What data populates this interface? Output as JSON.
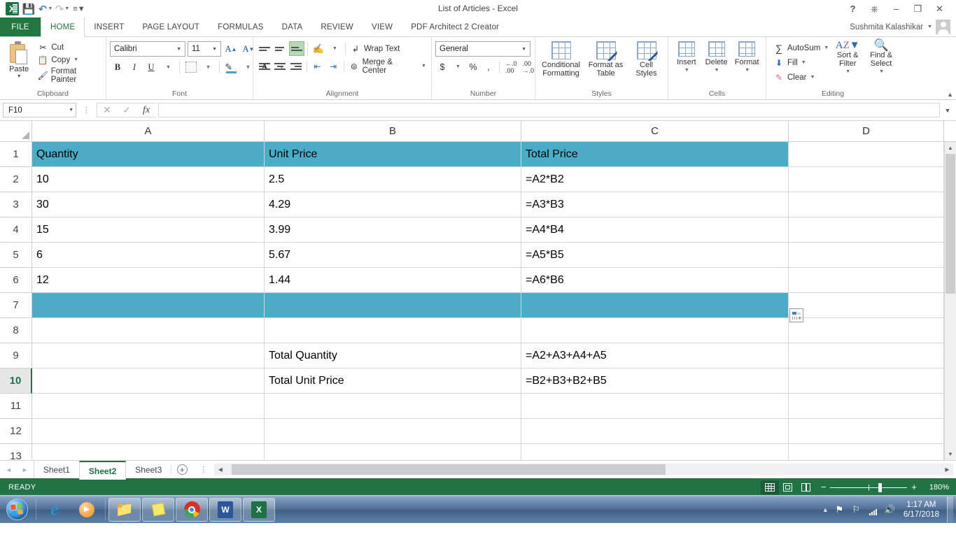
{
  "titlebar": {
    "title": "List of Articles - Excel",
    "quick_access": [
      {
        "name": "save",
        "label": "Save"
      },
      {
        "name": "undo",
        "label": "Undo"
      },
      {
        "name": "redo",
        "label": "Redo"
      },
      {
        "name": "customize",
        "label": "Customize Quick Access Toolbar"
      }
    ],
    "help_label": "?",
    "ribbon_options_label": "Ribbon Display Options",
    "minimize_label": "–",
    "restore_label": "❐",
    "close_label": "✕"
  },
  "ribbon": {
    "tabs": [
      {
        "label": "FILE",
        "active": false
      },
      {
        "label": "HOME",
        "active": true
      },
      {
        "label": "INSERT",
        "active": false
      },
      {
        "label": "PAGE LAYOUT",
        "active": false
      },
      {
        "label": "FORMULAS",
        "active": false
      },
      {
        "label": "DATA",
        "active": false
      },
      {
        "label": "REVIEW",
        "active": false
      },
      {
        "label": "VIEW",
        "active": false
      },
      {
        "label": "PDF Architect 2 Creator",
        "active": false
      }
    ],
    "user_name": "Sushmita Kalashikar",
    "clipboard": {
      "group_label": "Clipboard",
      "paste_label": "Paste",
      "cut_label": "Cut",
      "copy_label": "Copy",
      "format_painter_label": "Format Painter"
    },
    "font": {
      "group_label": "Font",
      "font_name": "Calibri",
      "font_size": "11",
      "grow_label": "A",
      "shrink_label": "A",
      "bold_label": "B",
      "italic_label": "I",
      "underline_label": "U",
      "borders_label": "Borders",
      "fill_color_label": "Fill Color",
      "font_color_label": "A"
    },
    "alignment": {
      "group_label": "Alignment",
      "top_align_label": "Top Align",
      "middle_align_label": "Middle Align",
      "bottom_align_label": "Bottom Align",
      "orientation_label": "Orientation",
      "align_left_label": "Align Left",
      "center_label": "Center",
      "align_right_label": "Align Right",
      "decrease_indent_label": "Decrease Indent",
      "increase_indent_label": "Increase Indent",
      "wrap_text_label": "Wrap Text",
      "merge_center_label": "Merge & Center"
    },
    "number": {
      "group_label": "Number",
      "format": "General",
      "accounting_label": "$",
      "percent_label": "%",
      "comma_label": ",",
      "increase_decimal_label": "Increase Decimal",
      "decrease_decimal_label": "Decrease Decimal"
    },
    "styles": {
      "group_label": "Styles",
      "conditional_formatting_label": "Conditional Formatting",
      "format_as_table_label": "Format as Table",
      "cell_styles_label": "Cell Styles"
    },
    "cells": {
      "group_label": "Cells",
      "insert_label": "Insert",
      "delete_label": "Delete",
      "format_label": "Format"
    },
    "editing": {
      "group_label": "Editing",
      "autosum_label": "AutoSum",
      "fill_label": "Fill",
      "clear_label": "Clear",
      "sort_filter_label": "Sort & Filter",
      "find_select_label": "Find & Select"
    }
  },
  "formula_bar": {
    "name_box": "F10",
    "cancel_label": "✕",
    "enter_label": "✓",
    "function_label": "fx",
    "formula_value": "",
    "formula_placeholder": ""
  },
  "grid": {
    "column_headers": [
      "A",
      "B",
      "C",
      "D"
    ],
    "row_headers": [
      "1",
      "2",
      "3",
      "4",
      "5",
      "6",
      "7",
      "8",
      "9",
      "10",
      "11",
      "12",
      "13"
    ],
    "active_row": "10",
    "header_fill_color": "#4aacc6",
    "rows": [
      {
        "num": "1",
        "cells": [
          {
            "v": "Quantity",
            "teal": true
          },
          {
            "v": "Unit Price",
            "teal": true
          },
          {
            "v": "Total Price",
            "teal": true
          },
          {
            "v": "",
            "teal": false
          }
        ]
      },
      {
        "num": "2",
        "cells": [
          {
            "v": "10",
            "teal": false
          },
          {
            "v": "2.5",
            "teal": false
          },
          {
            "v": "=A2*B2",
            "teal": false
          },
          {
            "v": "",
            "teal": false
          }
        ]
      },
      {
        "num": "3",
        "cells": [
          {
            "v": "30",
            "teal": false
          },
          {
            "v": "4.29",
            "teal": false
          },
          {
            "v": "=A3*B3",
            "teal": false
          },
          {
            "v": "",
            "teal": false
          }
        ]
      },
      {
        "num": "4",
        "cells": [
          {
            "v": "15",
            "teal": false
          },
          {
            "v": "3.99",
            "teal": false
          },
          {
            "v": "=A4*B4",
            "teal": false
          },
          {
            "v": "",
            "teal": false
          }
        ]
      },
      {
        "num": "5",
        "cells": [
          {
            "v": "6",
            "teal": false
          },
          {
            "v": "5.67",
            "teal": false
          },
          {
            "v": "=A5*B5",
            "teal": false
          },
          {
            "v": "",
            "teal": false
          }
        ]
      },
      {
        "num": "6",
        "cells": [
          {
            "v": "12",
            "teal": false
          },
          {
            "v": "1.44",
            "teal": false
          },
          {
            "v": "=A6*B6",
            "teal": false
          },
          {
            "v": "",
            "teal": false
          }
        ]
      },
      {
        "num": "7",
        "cells": [
          {
            "v": "",
            "teal": true
          },
          {
            "v": "",
            "teal": true
          },
          {
            "v": "",
            "teal": true
          },
          {
            "v": "",
            "teal": false
          }
        ]
      },
      {
        "num": "8",
        "cells": [
          {
            "v": "",
            "teal": false
          },
          {
            "v": "",
            "teal": false
          },
          {
            "v": "",
            "teal": false
          },
          {
            "v": "",
            "teal": false
          }
        ]
      },
      {
        "num": "9",
        "cells": [
          {
            "v": "",
            "teal": false
          },
          {
            "v": "Total Quantity",
            "teal": false
          },
          {
            "v": "=A2+A3+A4+A5",
            "teal": false
          },
          {
            "v": "",
            "teal": false
          }
        ]
      },
      {
        "num": "10",
        "cells": [
          {
            "v": "",
            "teal": false
          },
          {
            "v": "Total Unit Price",
            "teal": false
          },
          {
            "v": "=B2+B3+B2+B5",
            "teal": false
          },
          {
            "v": "",
            "teal": false
          }
        ]
      },
      {
        "num": "11",
        "cells": [
          {
            "v": "",
            "teal": false
          },
          {
            "v": "",
            "teal": false
          },
          {
            "v": "",
            "teal": false
          },
          {
            "v": "",
            "teal": false
          }
        ]
      },
      {
        "num": "12",
        "cells": [
          {
            "v": "",
            "teal": false
          },
          {
            "v": "",
            "teal": false
          },
          {
            "v": "",
            "teal": false
          },
          {
            "v": "",
            "teal": false
          }
        ]
      },
      {
        "num": "13",
        "cells": [
          {
            "v": "",
            "teal": false
          },
          {
            "v": "",
            "teal": false
          },
          {
            "v": "",
            "teal": false
          },
          {
            "v": "",
            "teal": false
          }
        ]
      }
    ],
    "quick_analysis_label": "Quick Analysis"
  },
  "sheet_tabs": {
    "prev_label": "◄",
    "next_label": "►",
    "tabs": [
      {
        "label": "Sheet1",
        "active": false
      },
      {
        "label": "Sheet2",
        "active": true
      },
      {
        "label": "Sheet3",
        "active": false
      }
    ],
    "add_label": "+"
  },
  "status_bar": {
    "status": "READY",
    "view_normal_label": "Normal",
    "view_page_layout_label": "Page Layout",
    "view_page_break_label": "Page Break Preview",
    "zoom_out_label": "−",
    "zoom_in_label": "+",
    "zoom_level": "180%"
  },
  "taskbar": {
    "start_label": "Start",
    "items": [
      {
        "name": "internet-explorer",
        "label": "Internet Explorer"
      },
      {
        "name": "windows-media-player",
        "label": "Windows Media Player"
      },
      {
        "name": "file-explorer",
        "label": "Windows Explorer"
      },
      {
        "name": "sticky-notes",
        "label": "Sticky Notes"
      },
      {
        "name": "google-chrome",
        "label": "Google Chrome"
      },
      {
        "name": "microsoft-word",
        "label": "Microsoft Word"
      },
      {
        "name": "microsoft-excel",
        "label": "Microsoft Excel"
      }
    ],
    "tray": {
      "show_hidden_label": "▲",
      "network_label": "Network",
      "volume_label": "Volume",
      "action_center_label": "Action Center",
      "time": "1:17 AM",
      "date": "6/17/2018"
    }
  }
}
